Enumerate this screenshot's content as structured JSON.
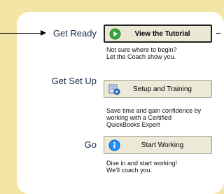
{
  "steps": [
    {
      "label": "Get Ready",
      "button": "View the Tutorial",
      "icon": "play-icon",
      "description": [
        "Not sure where to begin?",
        "Let the Coach show you."
      ]
    },
    {
      "label": "Get Set Up",
      "button": "Setup and Training",
      "icon": "setup-icon",
      "description": [
        "Save time and gain confidence by",
        "working with a Certified",
        "QuickBooks Expert"
      ]
    },
    {
      "label": "Go",
      "button": "Start Working",
      "icon": "info-icon",
      "description": [
        "Dive in and start working!",
        "We'll coach you."
      ]
    }
  ],
  "colors": {
    "background": "#f3e5a6",
    "panel": "#ffffff",
    "play_green": "#3aa53a",
    "info_blue": "#1e90ff"
  }
}
